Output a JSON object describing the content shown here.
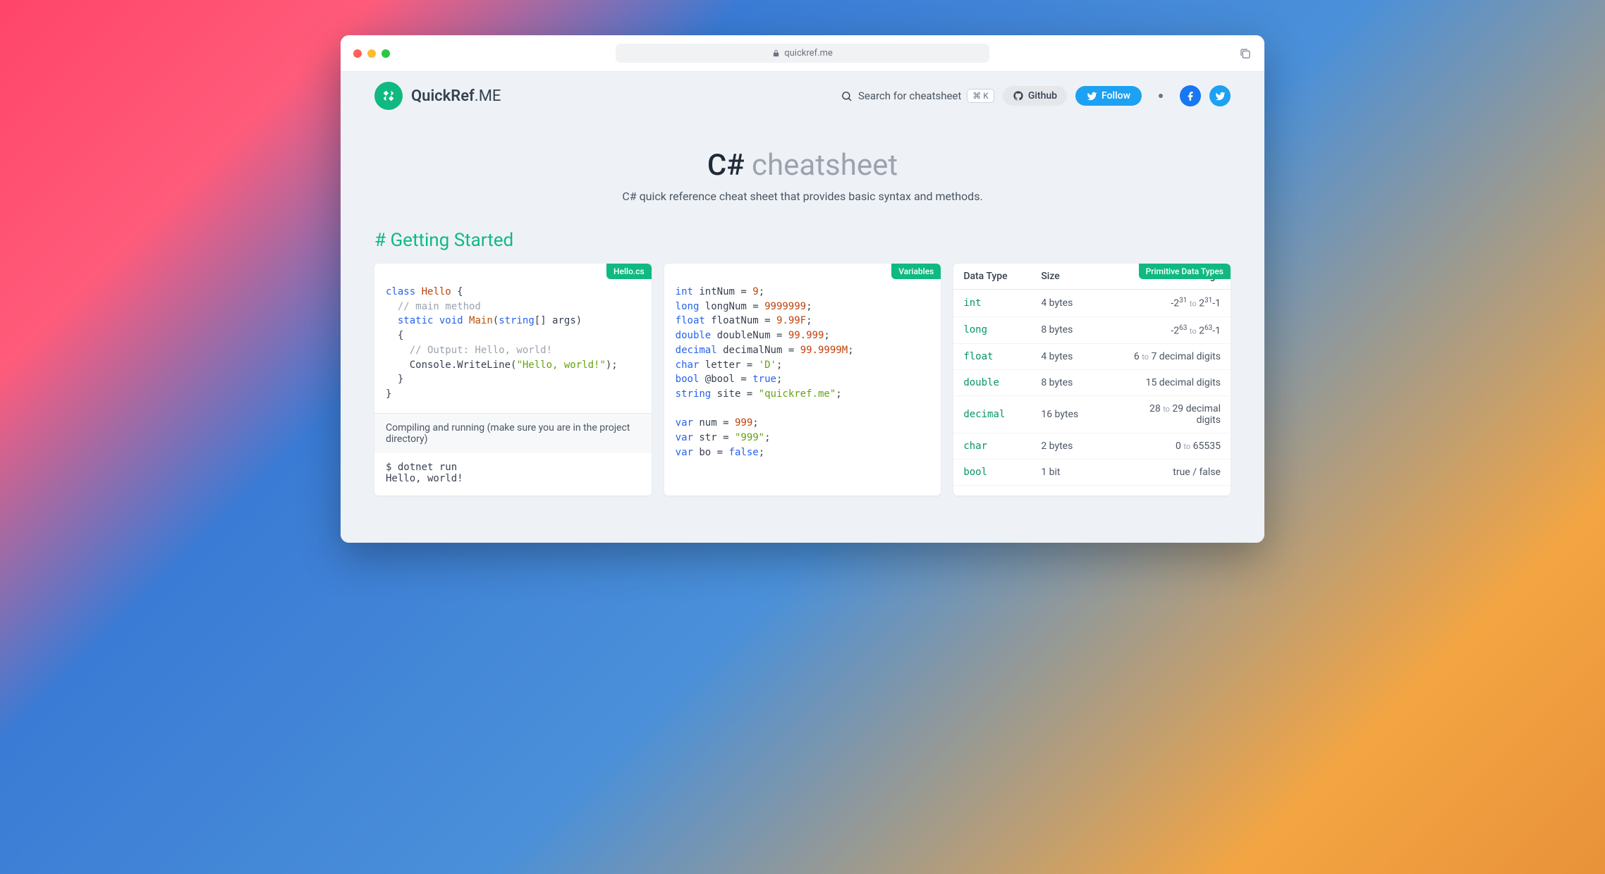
{
  "browser": {
    "url_host": "quickref.me"
  },
  "nav": {
    "brand_a": "QuickRef",
    "brand_b": ".ME",
    "search_placeholder": "Search for cheatsheet",
    "shortcut": "⌘ K",
    "github": "Github",
    "follow": "Follow"
  },
  "hero": {
    "lang": "C#",
    "suffix": " cheatsheet",
    "subtitle": "C# quick reference cheat sheet that provides basic syntax and methods."
  },
  "section": {
    "hash": "#",
    "title": " Getting Started"
  },
  "card1": {
    "tag": "Hello.cs",
    "note": "Compiling and running (make sure you are in the project directory)",
    "run_cmd": "$ dotnet run",
    "run_out": "Hello, world!",
    "tok": {
      "class": "class",
      "hello": "Hello",
      "lb": " {",
      "cm1": "// main method",
      "static": "static",
      "void": "void",
      "main": "Main",
      "lp": "(",
      "string": "string",
      "arr": "[] args)",
      "lb2": "{",
      "cm2": "// Output: Hello, world!",
      "console": "Console.WriteLine(",
      "hw": "\"Hello, world!\"",
      "end": ");",
      "rb": "}",
      "rb2": "}"
    }
  },
  "card2": {
    "tag": "Variables",
    "tok": {
      "int": "int",
      "intNum": " intNum = ",
      "nine": "9",
      "sc": ";",
      "long": "long",
      "longNum": " longNum = ",
      "ln": "9999999",
      "float": "float",
      "floatNum": " floatNum = ",
      "fn": "9.99F",
      "double": "double",
      "doubleNum": " doubleNum = ",
      "dn": "99.999",
      "decimal": "decimal",
      "decNum": " decimalNum = ",
      "den": "99.9999M",
      "char": "char",
      "letter": " letter = ",
      "d": "'D'",
      "bool": "bool",
      "atbool": " @bool = ",
      "true": "true",
      "string": "string",
      "site": " site = ",
      "qr": "\"quickref.me\"",
      "var": "var",
      "num": " num = ",
      "n999": "999",
      "str": " str = ",
      "s999": "\"999\"",
      "bo": " bo = ",
      "false": "false"
    }
  },
  "card3": {
    "tag": "Primitive Data Types",
    "headers": {
      "type": "Data Type",
      "size": "Size",
      "range": "Range"
    },
    "rows": [
      {
        "type": "int",
        "size": "4 bytes",
        "range_html": "-2<sup>31</sup> <span class='to'>to</span> 2<sup>31</sup>-1"
      },
      {
        "type": "long",
        "size": "8 bytes",
        "range_html": "-2<sup>63</sup> <span class='to'>to</span> 2<sup>63</sup>-1"
      },
      {
        "type": "float",
        "size": "4 bytes",
        "range_html": "6 <span class='to'>to</span> 7 decimal digits"
      },
      {
        "type": "double",
        "size": "8 bytes",
        "range_html": "15 decimal digits"
      },
      {
        "type": "decimal",
        "size": "16 bytes",
        "range_html": "28 <span class='to'>to</span> 29 decimal<br>digits"
      },
      {
        "type": "char",
        "size": "2 bytes",
        "range_html": "0 <span class='to'>to</span> 65535"
      },
      {
        "type": "bool",
        "size": "1 bit",
        "range_html": "true / false"
      }
    ]
  }
}
